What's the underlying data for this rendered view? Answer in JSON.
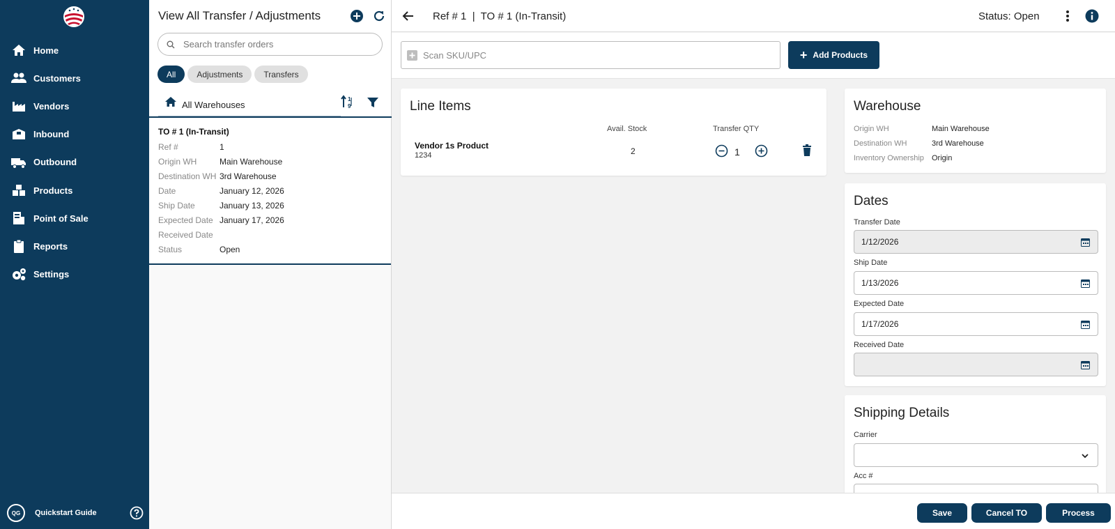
{
  "sidebar": {
    "items": [
      {
        "label": "Home",
        "icon": "home-icon"
      },
      {
        "label": "Customers",
        "icon": "customers-icon"
      },
      {
        "label": "Vendors",
        "icon": "vendors-icon"
      },
      {
        "label": "Inbound",
        "icon": "inbound-icon"
      },
      {
        "label": "Outbound",
        "icon": "outbound-icon"
      },
      {
        "label": "Products",
        "icon": "products-icon"
      },
      {
        "label": "Point of Sale",
        "icon": "point-of-sale-icon"
      },
      {
        "label": "Reports",
        "icon": "reports-icon"
      },
      {
        "label": "Settings",
        "icon": "settings-icon"
      }
    ],
    "footer": {
      "badge": "QG",
      "label": "Quickstart Guide"
    }
  },
  "list_panel": {
    "title": "View All Transfer / Adjustments",
    "search_placeholder": "Search transfer orders",
    "chips": [
      "All",
      "Adjustments",
      "Transfers"
    ],
    "active_chip": "All",
    "warehouse_filter": "All Warehouses",
    "card": {
      "title": "TO # 1 (In-Transit)",
      "rows": [
        {
          "key": "Ref #",
          "value": "1"
        },
        {
          "key": "Origin WH",
          "value": "Main Warehouse"
        },
        {
          "key": "Destination WH",
          "value": "3rd Warehouse"
        },
        {
          "key": "Date",
          "value": "January 12, 2026"
        },
        {
          "key": "Ship Date",
          "value": "January 13, 2026"
        },
        {
          "key": "Expected Date",
          "value": "January 17, 2026"
        },
        {
          "key": "Received Date",
          "value": ""
        },
        {
          "key": "Status",
          "value": "Open"
        }
      ]
    }
  },
  "header": {
    "title": "Ref # 1  |  TO # 1 (In-Transit)",
    "status": "Status: Open"
  },
  "scan": {
    "placeholder": "Scan SKU/UPC",
    "add_products_label": "Add Products"
  },
  "line_items": {
    "title": "Line Items",
    "col_stock": "Avail. Stock",
    "col_qty": "Transfer QTY",
    "items": [
      {
        "name": "Vendor 1s Product",
        "sku": "1234",
        "stock": "2",
        "qty": "1"
      }
    ]
  },
  "warehouse": {
    "title": "Warehouse",
    "rows": [
      {
        "key": "Origin WH",
        "value": "Main Warehouse"
      },
      {
        "key": "Destination WH",
        "value": "3rd Warehouse"
      },
      {
        "key": "Inventory Ownership",
        "value": "Origin"
      }
    ]
  },
  "dates": {
    "title": "Dates",
    "fields": [
      {
        "label": "Transfer Date",
        "value": "1/12/2026"
      },
      {
        "label": "Ship Date",
        "value": "1/13/2026"
      },
      {
        "label": "Expected Date",
        "value": "1/17/2026"
      },
      {
        "label": "Received Date",
        "value": ""
      }
    ]
  },
  "shipping": {
    "title": "Shipping Details",
    "carrier_label": "Carrier",
    "carrier_value": "",
    "acc_label": "Acc #"
  },
  "footer_buttons": {
    "save": "Save",
    "cancel": "Cancel TO",
    "process": "Process"
  },
  "colors": {
    "primary": "#0d3b5c",
    "sidebar_bg": "#0d3b5c",
    "chip_inactive": "#e0e0e0",
    "page_bg": "#f2f2f2"
  }
}
